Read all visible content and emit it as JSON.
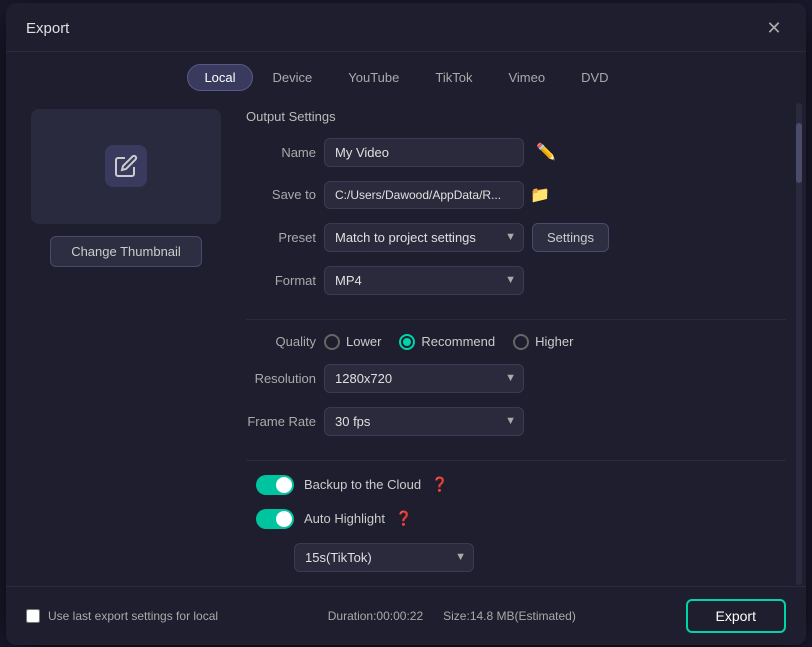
{
  "dialog": {
    "title": "Export",
    "close_label": "✕"
  },
  "tabs": [
    {
      "label": "Local",
      "active": true
    },
    {
      "label": "Device",
      "active": false
    },
    {
      "label": "YouTube",
      "active": false
    },
    {
      "label": "TikTok",
      "active": false
    },
    {
      "label": "Vimeo",
      "active": false
    },
    {
      "label": "DVD",
      "active": false
    }
  ],
  "thumbnail": {
    "change_label": "Change Thumbnail"
  },
  "output_settings": {
    "section_title": "Output Settings",
    "name_label": "Name",
    "name_value": "My Video",
    "save_to_label": "Save to",
    "save_to_value": "C:/Users/Dawood/AppData/R...",
    "preset_label": "Preset",
    "preset_value": "Match to project settings",
    "format_label": "Format",
    "format_value": "MP4",
    "settings_label": "Settings",
    "quality_label": "Quality",
    "quality_options": [
      {
        "label": "Lower",
        "selected": false
      },
      {
        "label": "Recommend",
        "selected": true
      },
      {
        "label": "Higher",
        "selected": false
      }
    ],
    "resolution_label": "Resolution",
    "resolution_value": "1280x720",
    "frame_rate_label": "Frame Rate",
    "frame_rate_value": "30 fps"
  },
  "cloud_backup": {
    "label": "Backup to the Cloud",
    "enabled": true
  },
  "auto_highlight": {
    "label": "Auto Highlight",
    "enabled": true,
    "option_value": "15s(TikTok)"
  },
  "footer": {
    "checkbox_label": "Use last export settings for local",
    "duration_label": "Duration:00:00:22",
    "size_label": "Size:14.8 MB(Estimated)",
    "export_label": "Export"
  }
}
